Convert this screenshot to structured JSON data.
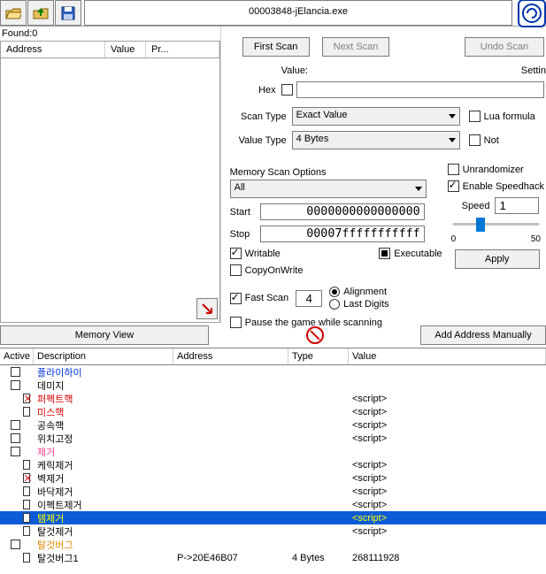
{
  "process_title": "00003848-jElancia.exe",
  "found_label": "Found:0",
  "results_headers": {
    "address": "Address",
    "value": "Value",
    "prev": "Pr..."
  },
  "settings_label": "Settin",
  "buttons": {
    "first_scan": "First Scan",
    "next_scan": "Next Scan",
    "undo_scan": "Undo Scan",
    "memory_view": "Memory View",
    "add_manual": "Add Address Manually",
    "apply": "Apply"
  },
  "labels": {
    "value": "Value:",
    "hex": "Hex",
    "scan_type": "Scan Type",
    "value_type": "Value Type",
    "mem_scan": "Memory Scan Options",
    "start": "Start",
    "stop": "Stop",
    "writable": "Writable",
    "executable": "Executable",
    "copy_on_write": "CopyOnWrite",
    "fast_scan": "Fast Scan",
    "alignment": "Alignment",
    "last_digits": "Last Digits",
    "pause": "Pause the game while scanning",
    "lua": "Lua formula",
    "not": "Not",
    "unrand": "Unrandomizer",
    "speedhack": "Enable Speedhack",
    "speed": "Speed"
  },
  "combo": {
    "scan_type": "Exact Value",
    "value_type": "4 Bytes",
    "mem_region": "All"
  },
  "values": {
    "start_addr": "0000000000000000",
    "stop_addr": "00007fffffffffff",
    "fast_scan": "4",
    "speed": "1",
    "scale_min": "0",
    "scale_max": "50"
  },
  "ct_headers": {
    "active": "Active",
    "desc": "Description",
    "addr": "Address",
    "type": "Type",
    "val": "Value"
  },
  "rows": [
    {
      "ind": 0,
      "cb": "",
      "desc": "플라이하이",
      "cls": "c-blue",
      "addr": "",
      "type": "",
      "val": ""
    },
    {
      "ind": 0,
      "cb": "",
      "desc": "데미지",
      "cls": "",
      "addr": "",
      "type": "",
      "val": ""
    },
    {
      "ind": 1,
      "cb": "x",
      "desc": "퍼펙트핵",
      "cls": "c-red",
      "addr": "",
      "type": "",
      "val": "<script>"
    },
    {
      "ind": 1,
      "cb": "",
      "desc": "미스핵",
      "cls": "c-red",
      "addr": "",
      "type": "",
      "val": "<script>"
    },
    {
      "ind": 0,
      "cb": "",
      "desc": "공속핵",
      "cls": "",
      "addr": "",
      "type": "",
      "val": "<script>"
    },
    {
      "ind": 0,
      "cb": "",
      "desc": "위치고정",
      "cls": "",
      "addr": "",
      "type": "",
      "val": "<script>"
    },
    {
      "ind": 0,
      "cb": "",
      "desc": "제거",
      "cls": "c-pink",
      "addr": "",
      "type": "",
      "val": ""
    },
    {
      "ind": 1,
      "cb": "",
      "desc": "케릭제거",
      "cls": "",
      "addr": "",
      "type": "",
      "val": "<script>"
    },
    {
      "ind": 1,
      "cb": "x",
      "desc": "벽제거",
      "cls": "",
      "addr": "",
      "type": "",
      "val": "<script>"
    },
    {
      "ind": 1,
      "cb": "",
      "desc": "바닥제거",
      "cls": "",
      "addr": "",
      "type": "",
      "val": "<script>"
    },
    {
      "ind": 1,
      "cb": "",
      "desc": "이펙트제거",
      "cls": "",
      "addr": "",
      "type": "",
      "val": "<script>"
    },
    {
      "ind": 1,
      "cb": "",
      "desc": "템제거",
      "cls": "",
      "addr": "",
      "type": "",
      "val": "<script>",
      "sel": true
    },
    {
      "ind": 1,
      "cb": "",
      "desc": "탈것제거",
      "cls": "",
      "addr": "",
      "type": "",
      "val": "<script>"
    },
    {
      "ind": 0,
      "cb": "",
      "desc": "탈것버그",
      "cls": "c-orange",
      "addr": "",
      "type": "",
      "val": ""
    },
    {
      "ind": 1,
      "cb": "",
      "desc": "탈것버그1",
      "cls": "",
      "addr": "P->20E46B07",
      "type": "4 Bytes",
      "val": "268111928"
    }
  ]
}
